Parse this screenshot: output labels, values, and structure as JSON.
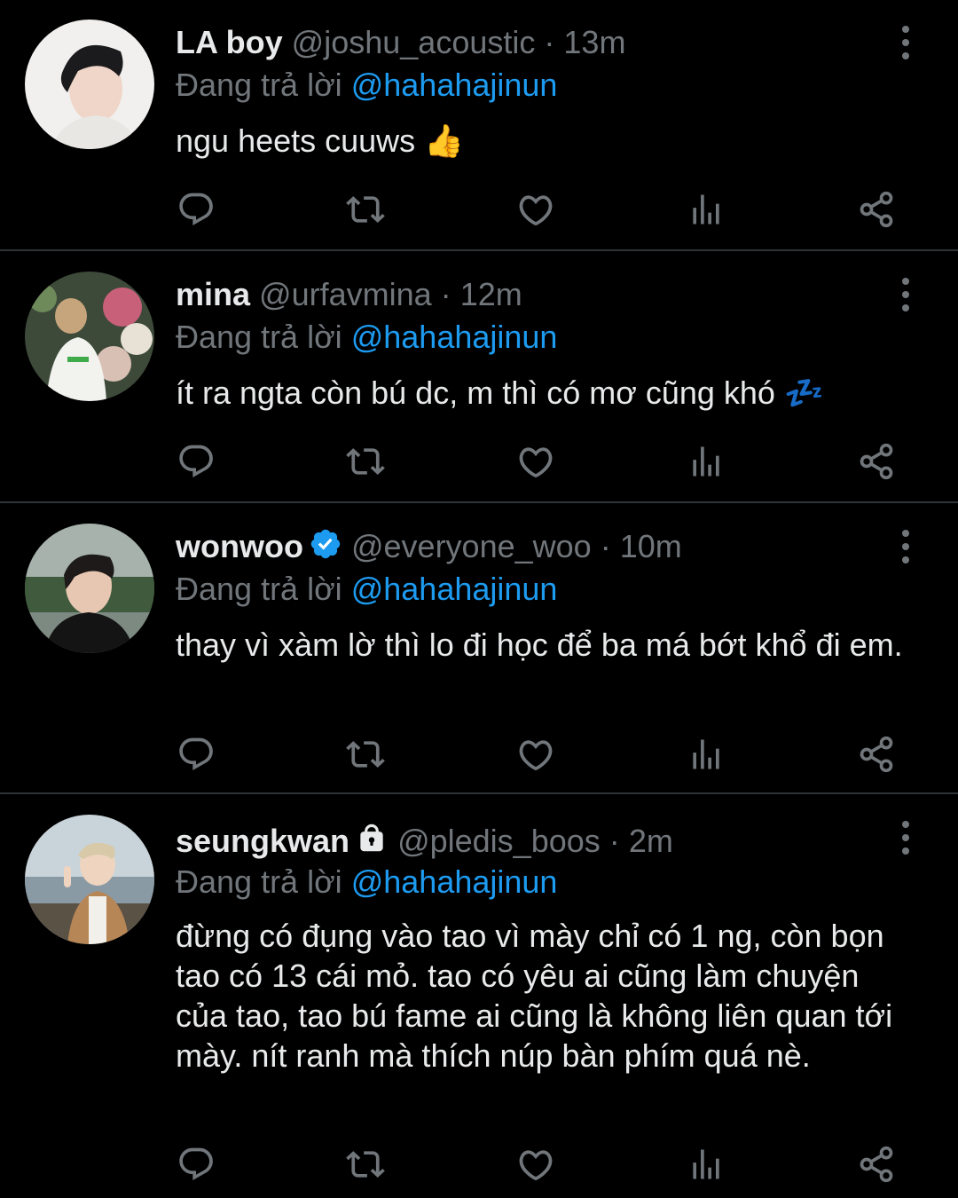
{
  "colors": {
    "background": "#000000",
    "text": "#e7e9ea",
    "muted": "#71767b",
    "accent": "#1d9bf0",
    "divider": "#2f3336"
  },
  "tweets": [
    {
      "name": "LA boy",
      "handle": "@joshu_acoustic",
      "sep": "·",
      "time": "13m",
      "reply_prefix": "Đang trả lời",
      "reply_to": "@hahahajinun",
      "body": "ngu heets cuuws",
      "emoji": "👍",
      "badge": "none",
      "avatar": "avatar-boy-white-shirt"
    },
    {
      "name": "mina",
      "handle": "@urfavmina",
      "sep": "·",
      "time": "12m",
      "reply_prefix": "Đang trả lời",
      "reply_to": "@hahahajinun",
      "body": "ít ra ngta còn bú dc, m thì có mơ cũng khó",
      "emoji": "💤",
      "badge": "none",
      "avatar": "avatar-girl-flowers"
    },
    {
      "name": "wonwoo",
      "handle": "@everyone_woo",
      "sep": "·",
      "time": "10m",
      "reply_prefix": "Đang trả lời",
      "reply_to": "@hahahajinun",
      "body": "thay vì xàm lờ thì lo đi học để ba má bớt khổ đi em.",
      "badge": "verified-icon",
      "avatar": "avatar-boy-outdoor"
    },
    {
      "name": "seungkwan",
      "handle": "@pledis_boos",
      "sep": "·",
      "time": "2m",
      "reply_prefix": "Đang trả lời",
      "reply_to": "@hahahajinun",
      "body": "đừng có đụng vào tao vì mày chỉ có 1 ng, còn bọn tao có 13 cái mỏ. tao có yêu ai cũng làm chuyện của tao, tao bú fame ai cũng là không liên quan tới mày. nít ranh mà thích núp bàn phím quá nè.",
      "badge": "lock-icon",
      "avatar": "avatar-boy-beach"
    }
  ],
  "action_icons": [
    "reply-icon",
    "retweet-icon",
    "like-icon",
    "views-icon",
    "share-icon"
  ]
}
